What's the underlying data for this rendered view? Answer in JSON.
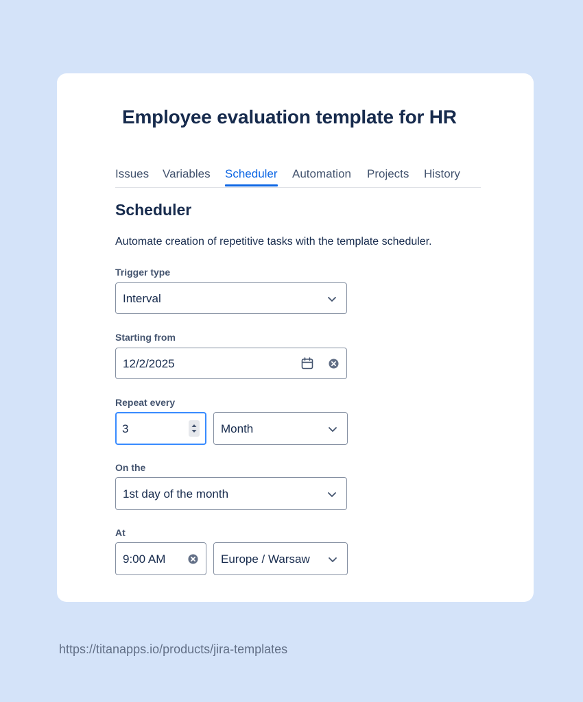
{
  "page": {
    "title": "Employee evaluation template for HR",
    "url": "https://titanapps.io/products/jira-templates"
  },
  "tabs": [
    {
      "label": "Issues"
    },
    {
      "label": "Variables"
    },
    {
      "label": "Scheduler",
      "active": true
    },
    {
      "label": "Automation"
    },
    {
      "label": "Projects"
    },
    {
      "label": "History"
    }
  ],
  "scheduler": {
    "heading": "Scheduler",
    "description": "Automate creation of repetitive tasks with the template scheduler.",
    "trigger_type": {
      "label": "Trigger type",
      "value": "Interval"
    },
    "starting_from": {
      "label": "Starting from",
      "value": "12/2/2025"
    },
    "repeat_every": {
      "label": "Repeat every",
      "value": "3",
      "unit": "Month"
    },
    "on_the": {
      "label": "On the",
      "value": "1st day of the month"
    },
    "at": {
      "label": "At",
      "time": "9:00 AM",
      "timezone": "Europe / Warsaw"
    }
  },
  "colors": {
    "accent": "#0c66e4",
    "focus": "#388bff",
    "background": "#d4e3f9",
    "text": "#172b4d"
  },
  "icons": {
    "dropdown": "chevron-down-icon",
    "calendar": "calendar-icon",
    "clear": "clear-icon",
    "stepper": "stepper-icon"
  }
}
